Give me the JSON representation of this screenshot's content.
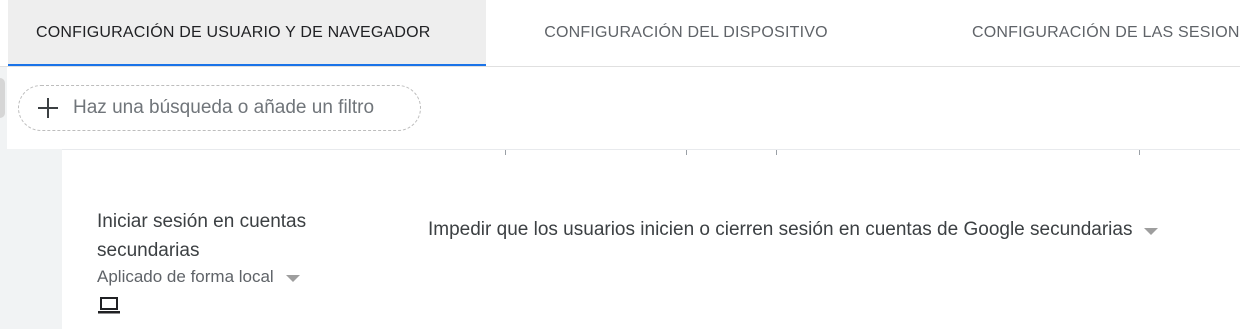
{
  "tabs": [
    {
      "label": "CONFIGURACIÓN DE USUARIO Y DE NAVEGADOR",
      "active": true
    },
    {
      "label": "CONFIGURACIÓN DEL DISPOSITIVO",
      "active": false
    },
    {
      "label": "CONFIGURACIÓN DE LAS SESIONES",
      "active": false
    }
  ],
  "filter": {
    "placeholder": "Haz una búsqueda o añade un filtro",
    "icon": "plus-icon"
  },
  "setting": {
    "name": "Iniciar sesión en cuentas secundarias",
    "source": "Aplicado de forma local",
    "source_icon": "laptop-icon",
    "value": "Impedir que los usuarios inicien o cierren sesión en cuentas de Google secundarias"
  },
  "colors": {
    "accent": "#1a73e8",
    "active_tab_bg": "#eeeeee",
    "muted_text": "#5f6368"
  }
}
